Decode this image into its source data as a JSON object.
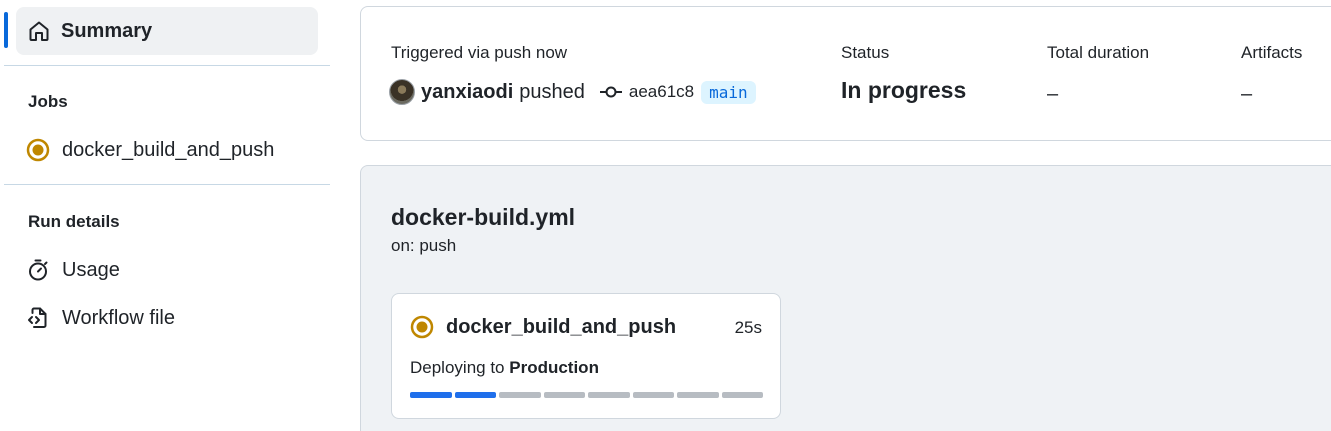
{
  "sidebar": {
    "summary_label": "Summary",
    "jobs_heading": "Jobs",
    "jobs": [
      {
        "label": "docker_build_and_push",
        "status": "in_progress"
      }
    ],
    "run_details_heading": "Run details",
    "run_details": [
      {
        "label": "Usage",
        "icon": "stopwatch-icon"
      },
      {
        "label": "Workflow file",
        "icon": "file-code-icon"
      }
    ]
  },
  "header": {
    "trigger_label": "Triggered via push now",
    "actor": "yanxiaodi",
    "action": "pushed",
    "commit_sha": "aea61c8",
    "branch": "main",
    "status_label": "Status",
    "status_value": "In progress",
    "duration_label": "Total duration",
    "duration_value": "–",
    "artifacts_label": "Artifacts",
    "artifacts_value": "–"
  },
  "graph": {
    "workflow_file": "docker-build.yml",
    "trigger": "on: push",
    "job": {
      "name": "docker_build_and_push",
      "duration": "25s",
      "deploy_prefix": "Deploying to",
      "environment": "Production",
      "steps_total": 8,
      "steps_done": 2
    }
  },
  "colors": {
    "accent": "#0969da",
    "in_progress": "#bf8700",
    "progress_done": "#1f6feb",
    "progress_pending": "#b7bcc2"
  }
}
